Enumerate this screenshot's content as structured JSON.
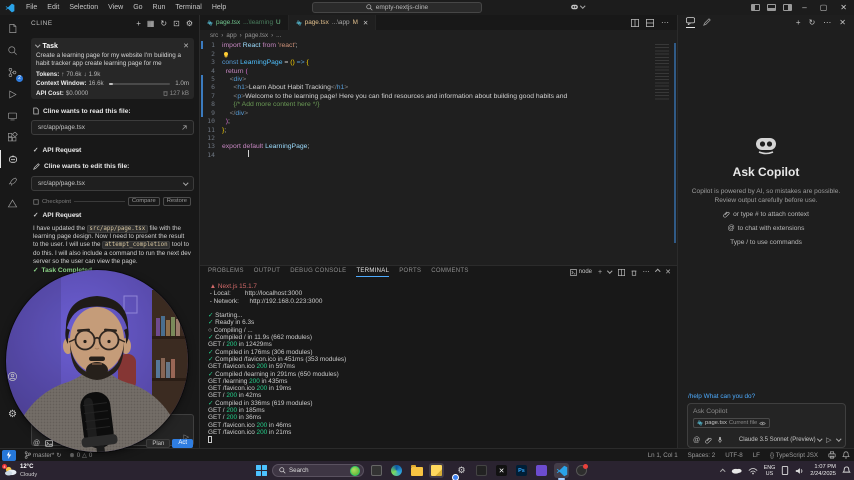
{
  "title_bar": {
    "menus": [
      "File",
      "Edit",
      "Selection",
      "View",
      "Go",
      "Run",
      "Terminal",
      "Help"
    ],
    "search": "empty-nextjs-cline",
    "minimize": "–",
    "maximize": "▢",
    "close": "✕"
  },
  "activity_bar": {
    "scm_badge": "2"
  },
  "sidebar": {
    "title": "CLINE",
    "task": {
      "header": "Task",
      "text": "Create a learning page for my website I'm building a habit tracker app create learning page for me",
      "tokens_label": "Tokens:",
      "tokens_up": "70.6k",
      "tokens_down": "1.9k",
      "context_label": "Context Window:",
      "context_used": "16.6k",
      "context_max": "1.0m",
      "cost_label": "API Cost:",
      "cost_value": "$0.0000",
      "cache": "127 kB"
    },
    "read_file_label": "Cline wants to read this file:",
    "read_file_path": "src/app/page.tsx",
    "api_request_label": "API Request",
    "edit_file_label": "Cline wants to edit this file:",
    "edit_file_path": "src/app/page.tsx",
    "checkpoint": {
      "label": "Checkpoint",
      "compare": "Compare",
      "restore": "Restore"
    },
    "message": [
      [
        "t",
        "I have updated the "
      ],
      [
        "code",
        "src/app/page.tsx"
      ],
      [
        "t",
        " file with the learning page design. Now I need to present the result to the user. I will use the "
      ],
      [
        "code",
        "attempt_completion"
      ],
      [
        "t",
        " tool to do this. I will also include a command to run the next dev server so the user can view the page."
      ]
    ],
    "task_completed": "Task Completed",
    "plan_label": "Plan",
    "act_label": "Act"
  },
  "editor": {
    "tabs": [
      {
        "name": "page.tsx",
        "detail": "...\\learning",
        "badge": "U",
        "active": false
      },
      {
        "name": "page.tsx",
        "detail": "...\\app",
        "badge": "M",
        "active": true
      }
    ],
    "breadcrumb": [
      "src",
      "app",
      "page.tsx",
      "..."
    ],
    "code": [
      {
        "n": 1,
        "mod": true,
        "s": [
          [
            "k",
            "import "
          ],
          [
            "v",
            "React "
          ],
          [
            "k",
            "from "
          ],
          [
            "s",
            "'react'"
          ],
          [
            "p",
            ";"
          ]
        ]
      },
      {
        "n": 2,
        "mod": false,
        "s": [
          [
            "p",
            " "
          ],
          [
            "bulb",
            ""
          ]
        ]
      },
      {
        "n": 3,
        "mod": false,
        "s": [
          [
            "b",
            "const "
          ],
          [
            "f",
            "LearningPage "
          ],
          [
            "p",
            "= "
          ],
          [
            "y",
            "()"
          ],
          [
            "b",
            " =>"
          ],
          [
            "p",
            " "
          ],
          [
            "y",
            "{"
          ]
        ]
      },
      {
        "n": 4,
        "mod": false,
        "s": [
          [
            "p",
            "  "
          ],
          [
            "k",
            "return "
          ],
          [
            "m",
            "("
          ]
        ]
      },
      {
        "n": 5,
        "mod": true,
        "s": [
          [
            "p",
            "    "
          ],
          [
            "a",
            "<"
          ],
          [
            "t",
            "div"
          ],
          [
            "a",
            ">"
          ]
        ]
      },
      {
        "n": 6,
        "mod": true,
        "s": [
          [
            "p",
            "      "
          ],
          [
            "a",
            "<"
          ],
          [
            "t",
            "h1"
          ],
          [
            "a",
            ">"
          ],
          [
            "x",
            "Learn About Habit Tracking"
          ],
          [
            "a",
            "</"
          ],
          [
            "t",
            "h1"
          ],
          [
            "a",
            ">"
          ]
        ]
      },
      {
        "n": 7,
        "mod": true,
        "s": [
          [
            "p",
            "      "
          ],
          [
            "a",
            "<"
          ],
          [
            "t",
            "p"
          ],
          [
            "a",
            ">"
          ],
          [
            "x",
            "Welcome to the learning page! Here you can find resources and information about building good habits and"
          ]
        ]
      },
      {
        "n": 8,
        "mod": true,
        "s": [
          [
            "p",
            "      "
          ],
          [
            "c",
            "{/* Add more content here */}"
          ]
        ]
      },
      {
        "n": 9,
        "mod": true,
        "s": [
          [
            "p",
            "    "
          ],
          [
            "a",
            "</"
          ],
          [
            "t",
            "div"
          ],
          [
            "a",
            ">"
          ]
        ]
      },
      {
        "n": 10,
        "mod": false,
        "s": [
          [
            "p",
            "  "
          ],
          [
            "m",
            ")"
          ],
          [
            "p",
            ";"
          ]
        ]
      },
      {
        "n": 11,
        "mod": false,
        "s": [
          [
            "y",
            "}"
          ],
          [
            "p",
            ";"
          ]
        ]
      },
      {
        "n": 12,
        "mod": false,
        "s": []
      },
      {
        "n": 13,
        "mod": false,
        "s": [
          [
            "k",
            "export default "
          ],
          [
            "v",
            "LearningPage"
          ],
          [
            "p",
            ";"
          ]
        ]
      },
      {
        "n": 14,
        "mod": false,
        "s": [
          [
            "cursor",
            ""
          ]
        ]
      }
    ]
  },
  "terminal": {
    "tabs": [
      "PROBLEMS",
      "OUTPUT",
      "DEBUG CONSOLE",
      "TERMINAL",
      "PORTS",
      "COMMENTS"
    ],
    "active": "TERMINAL",
    "shell_label": "node",
    "lines": [
      [
        [
          "r",
          " ▲ Next.js 15.1.7"
        ]
      ],
      [
        [
          "w",
          " - Local:        http://localhost:3000"
        ]
      ],
      [
        [
          "w",
          " - Network:      http://192.168.0.223:3000"
        ]
      ],
      [],
      [
        [
          "g",
          "✓"
        ],
        [
          "w",
          " Starting..."
        ]
      ],
      [
        [
          "g",
          "✓"
        ],
        [
          "w",
          " Ready in 6.3s"
        ]
      ],
      [
        [
          "w",
          "○ Compiling / ..."
        ]
      ],
      [
        [
          "g",
          "✓"
        ],
        [
          "w",
          " Compiled / in 11.9s (662 modules)"
        ]
      ],
      [
        [
          "w",
          "GET / "
        ],
        [
          "g",
          "200"
        ],
        [
          "w",
          " in 12429ms"
        ]
      ],
      [
        [
          "g",
          "✓"
        ],
        [
          "w",
          " Compiled in 176ms (306 modules)"
        ]
      ],
      [
        [
          "g",
          "✓"
        ],
        [
          "w",
          " Compiled /favicon.ico in 451ms (353 modules)"
        ]
      ],
      [
        [
          "w",
          "GET /favicon.ico "
        ],
        [
          "g",
          "200"
        ],
        [
          "w",
          " in 597ms"
        ]
      ],
      [
        [
          "g",
          "✓"
        ],
        [
          "w",
          " Compiled /learning in 291ms (650 modules)"
        ]
      ],
      [
        [
          "w",
          "GET /learning "
        ],
        [
          "g",
          "200"
        ],
        [
          "w",
          " in 435ms"
        ]
      ],
      [
        [
          "w",
          "GET /favicon.ico "
        ],
        [
          "g",
          "200"
        ],
        [
          "w",
          " in 19ms"
        ]
      ],
      [
        [
          "w",
          "GET / "
        ],
        [
          "g",
          "200"
        ],
        [
          "w",
          " in 42ms"
        ]
      ],
      [
        [
          "g",
          "✓"
        ],
        [
          "w",
          " Compiled in 336ms (619 modules)"
        ]
      ],
      [
        [
          "w",
          "GET / "
        ],
        [
          "g",
          "200"
        ],
        [
          "w",
          " in 185ms"
        ]
      ],
      [
        [
          "w",
          "GET / "
        ],
        [
          "g",
          "200"
        ],
        [
          "w",
          " in 36ms"
        ]
      ],
      [
        [
          "w",
          "GET /favicon.ico "
        ],
        [
          "g",
          "200"
        ],
        [
          "w",
          " in 46ms"
        ]
      ],
      [
        [
          "w",
          "GET /favicon.ico "
        ],
        [
          "g",
          "200"
        ],
        [
          "w",
          " in 21ms"
        ]
      ],
      [
        [
          "cur",
          ""
        ]
      ]
    ]
  },
  "copilot": {
    "title": "Ask Copilot",
    "disclaimer": "Copilot is powered by AI, so mistakes are possible. Review output carefully before use.",
    "hints": [
      {
        "icon": "paperclip-icon",
        "text": "or type # to attach context"
      },
      {
        "icon": "mention-icon",
        "text": "to chat with extensions"
      },
      {
        "icon": "",
        "text": "Type / to use commands"
      }
    ],
    "help_link": "/help What can you do?",
    "input_placeholder": "Ask Copilot",
    "chip_file": "page.tsx",
    "chip_note": "Current file",
    "model": "Claude 3.5 Sonnet (Preview)"
  },
  "status_bar": {
    "branch": "master*",
    "errors": "0",
    "warnings": "0",
    "right": [
      "Ln 1, Col 1",
      "Spaces: 2",
      "UTF-8",
      "LF",
      "{} TypeScript JSX"
    ]
  },
  "taskbar": {
    "weather_temp": "12°C",
    "weather_cond": "Cloudy",
    "search_placeholder": "Search",
    "lang_top": "ENG",
    "lang_bottom": "US",
    "time": "1:07 PM",
    "date": "2/24/2025"
  }
}
